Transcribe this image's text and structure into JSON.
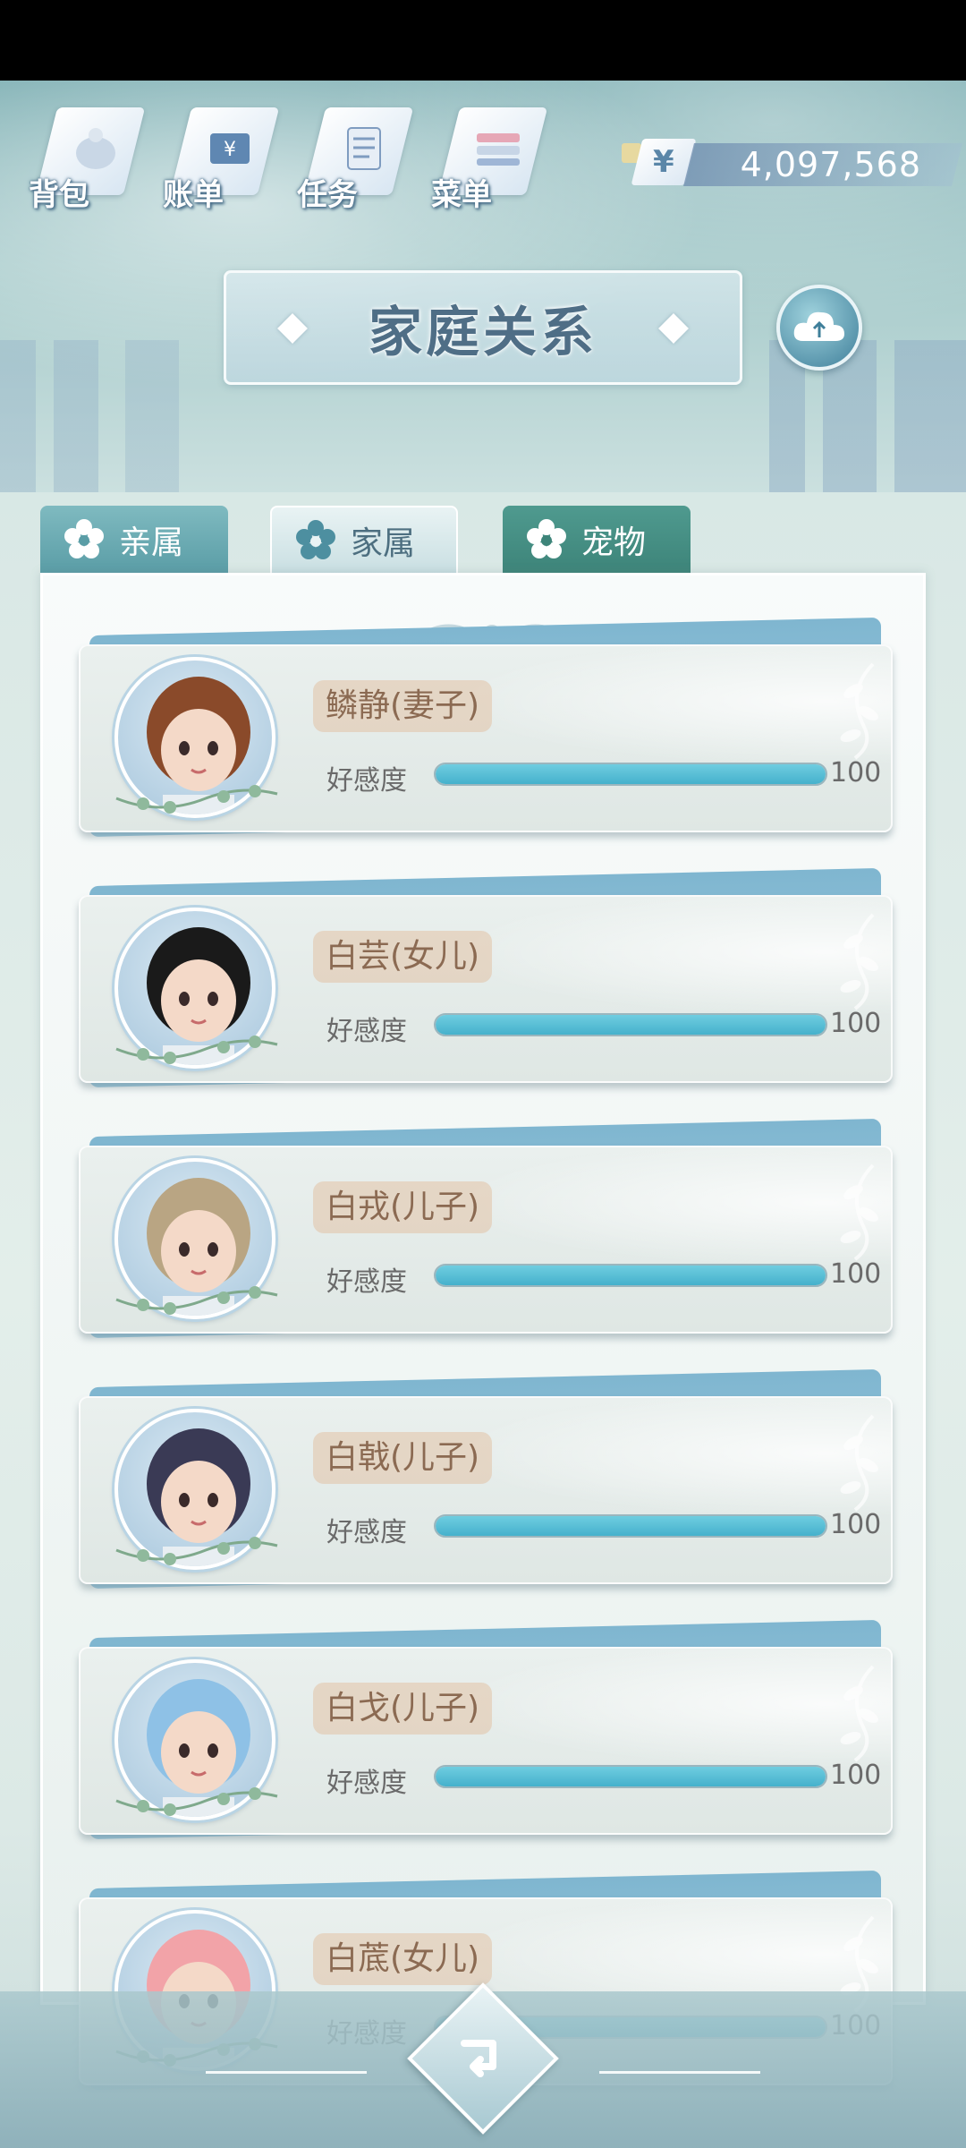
{
  "top_nav": [
    {
      "label": "背包",
      "icon": "bag-icon"
    },
    {
      "label": "账单",
      "icon": "bill-icon"
    },
    {
      "label": "任务",
      "icon": "task-icon"
    },
    {
      "label": "菜单",
      "icon": "menu-icon"
    }
  ],
  "currency": {
    "symbol": "¥",
    "value": "4,097,568"
  },
  "title": "家庭关系",
  "tabs": [
    {
      "label": "亲属",
      "selected": false
    },
    {
      "label": "家属",
      "selected": true
    },
    {
      "label": "宠物",
      "selected": false
    }
  ],
  "members": [
    {
      "name": "鳞静(妻子)",
      "affection_label": "好感度",
      "affection": "100",
      "affection_fraction": 1.0,
      "avatar": "woman-brown-hair"
    },
    {
      "name": "白芸(女儿)",
      "affection_label": "好感度",
      "affection": "100",
      "affection_fraction": 1.0,
      "avatar": "girl-black-pigtails"
    },
    {
      "name": "白戎(儿子)",
      "affection_label": "好感度",
      "affection": "100",
      "affection_fraction": 1.0,
      "avatar": "boy-light-hair"
    },
    {
      "name": "白戟(儿子)",
      "affection_label": "好感度",
      "affection": "100",
      "affection_fraction": 1.0,
      "avatar": "boy-dark-hair"
    },
    {
      "name": "白戈(儿子)",
      "affection_label": "好感度",
      "affection": "100",
      "affection_fraction": 1.0,
      "avatar": "child-blue-hat"
    },
    {
      "name": "白菧(女儿)",
      "affection_label": "好感度",
      "affection": "100",
      "affection_fraction": 1.0,
      "avatar": "child-pink-hat"
    }
  ],
  "colors": {
    "accent": "#45b1cc",
    "title": "#4f6e86",
    "name_tag": "#8b6a52"
  }
}
